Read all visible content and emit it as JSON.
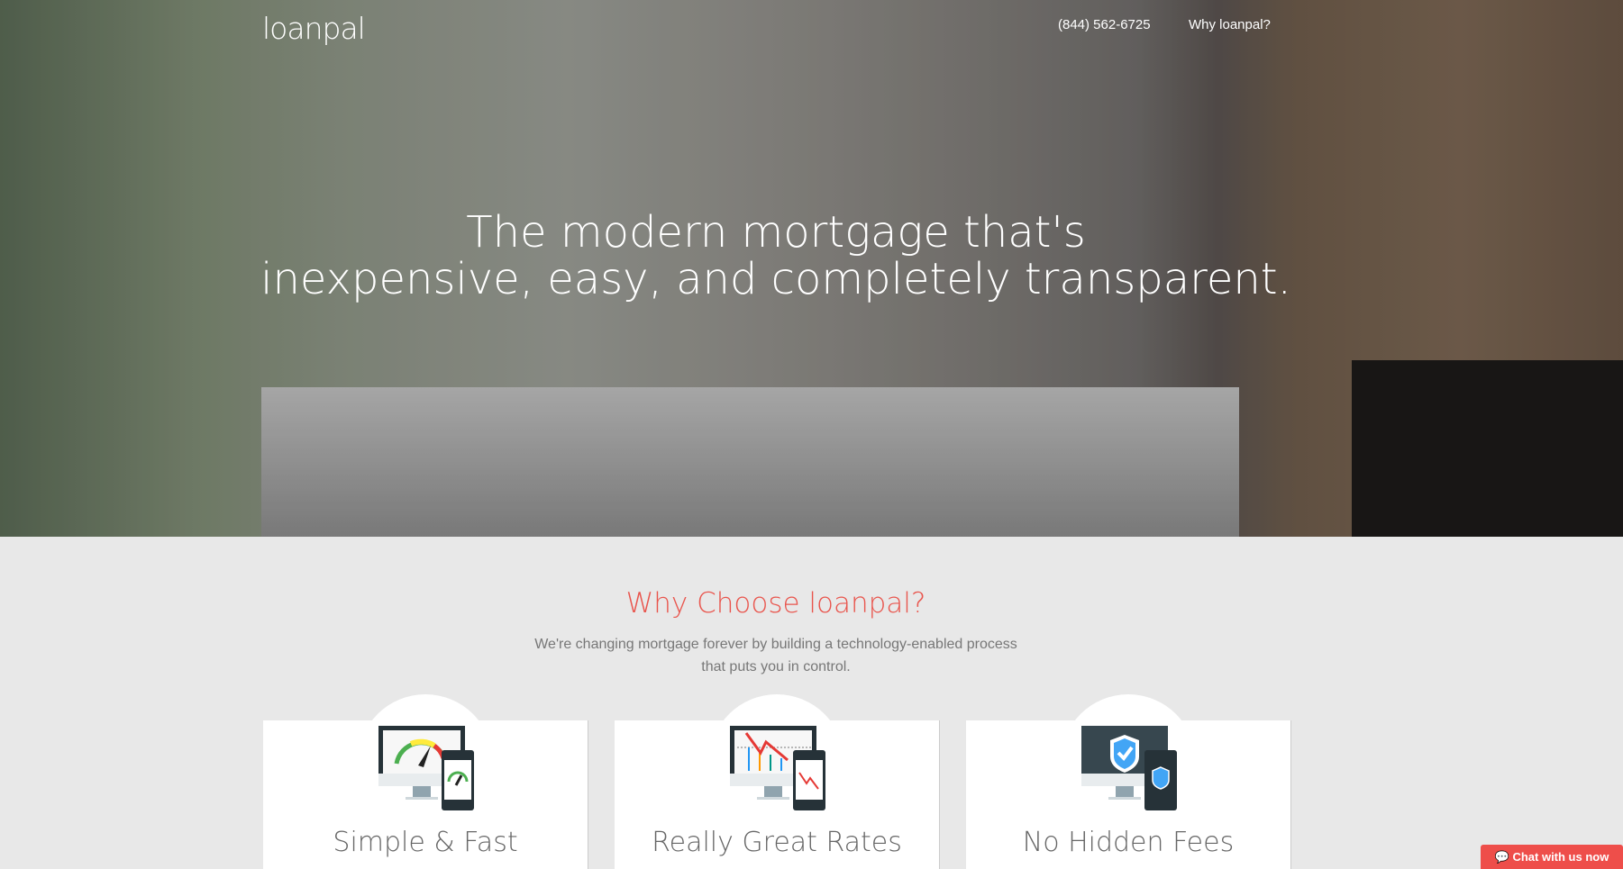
{
  "header": {
    "logo": "loanpal",
    "phone": "(844) 562-6725",
    "why_link": "Why loanpal?"
  },
  "hero": {
    "headline_line1": "The modern mortgage that's",
    "headline_line2": "inexpensive, easy, and completely transparent."
  },
  "section": {
    "title": "Why Choose loanpal?",
    "subtitle_line1": "We're changing mortgage forever by building a technology-enabled process",
    "subtitle_line2": "that puts you in control."
  },
  "features": [
    {
      "title": "Simple & Fast",
      "icon": "speedometer-devices-icon"
    },
    {
      "title": "Really Great Rates",
      "icon": "falling-chart-devices-icon"
    },
    {
      "title": "No Hidden Fees",
      "icon": "shield-check-devices-icon"
    }
  ],
  "chat": {
    "label": "Chat with us now",
    "icon": "speech-bubble-icon"
  },
  "colors": {
    "accent": "#e9554d",
    "chat": "#ee4e4a",
    "background": "#e8e8e8"
  }
}
